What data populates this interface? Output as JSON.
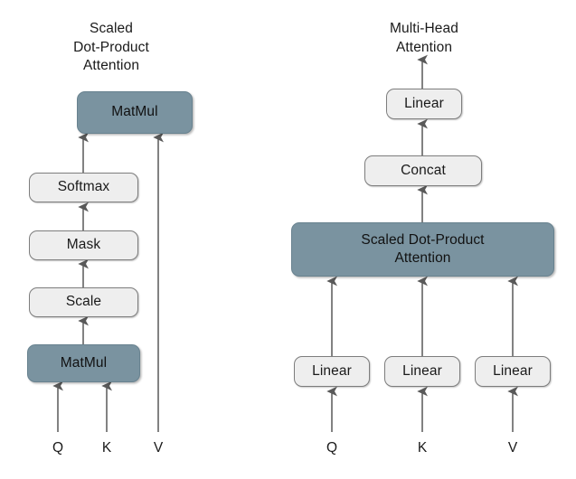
{
  "diagram": {
    "title_left": "Scaled\nDot-Product\nAttention",
    "title_right": "Multi-Head\nAttention",
    "colors": {
      "background": "#ffffff",
      "node_dark_fill": "#7a93a0",
      "node_dark_stroke": "#68828f",
      "node_light_fill": "#eeeeee",
      "node_light_stroke": "#7d7d7d",
      "arrow": "#595959",
      "text": "#1a1a1a"
    }
  },
  "left_panel": {
    "name": "Scaled Dot-Product Attention",
    "nodes": [
      {
        "id": "l-matmul-top",
        "label": "MatMul",
        "style": "dark"
      },
      {
        "id": "l-softmax",
        "label": "Softmax",
        "style": "light"
      },
      {
        "id": "l-mask",
        "label": "Mask",
        "style": "light"
      },
      {
        "id": "l-scale",
        "label": "Scale",
        "style": "light"
      },
      {
        "id": "l-matmul-bottom",
        "label": "MatMul",
        "style": "dark"
      }
    ],
    "inputs": [
      {
        "id": "l-q",
        "label": "Q"
      },
      {
        "id": "l-k",
        "label": "K"
      },
      {
        "id": "l-v",
        "label": "V"
      }
    ]
  },
  "right_panel": {
    "name": "Multi-Head Attention",
    "nodes": [
      {
        "id": "r-linear-top",
        "label": "Linear",
        "style": "light"
      },
      {
        "id": "r-concat",
        "label": "Concat",
        "style": "light"
      },
      {
        "id": "r-sdpa",
        "label": "Scaled Dot-Product\nAttention",
        "style": "dark"
      },
      {
        "id": "r-linear-q",
        "label": "Linear",
        "style": "light"
      },
      {
        "id": "r-linear-k",
        "label": "Linear",
        "style": "light"
      },
      {
        "id": "r-linear-v",
        "label": "Linear",
        "style": "light"
      }
    ],
    "inputs": [
      {
        "id": "r-q",
        "label": "Q"
      },
      {
        "id": "r-k",
        "label": "K"
      },
      {
        "id": "r-v",
        "label": "V"
      }
    ]
  }
}
